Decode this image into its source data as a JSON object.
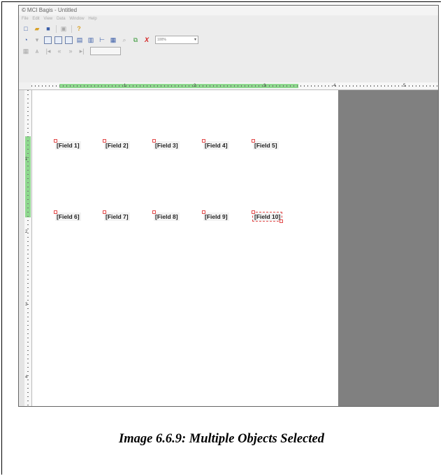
{
  "window": {
    "title": "MCI Bagis - Untitled"
  },
  "menu": [
    "File",
    "Edit",
    "View",
    "Data",
    "Window",
    "Help"
  ],
  "toolbar": {
    "zoom": "100%"
  },
  "ruler": {
    "h_numbers": [
      "1",
      "2",
      "3",
      "4",
      "5"
    ],
    "v_numbers": [
      "1",
      "2",
      "3",
      "4"
    ]
  },
  "fields": {
    "row1": [
      "[Field 1]",
      "[Field 2]",
      "[Field 3]",
      "[Field 4]",
      "[Field 5]"
    ],
    "row2": [
      "[Field 6]",
      "[Field 7]",
      "[Field 8]",
      "[Field 9]",
      "[Field 10]"
    ]
  },
  "caption": "Image 6.6.9: Multiple Objects Selected",
  "colors": {
    "selection": "#8fd88f",
    "handle": "#e24a4a",
    "workspace": "#808080"
  }
}
